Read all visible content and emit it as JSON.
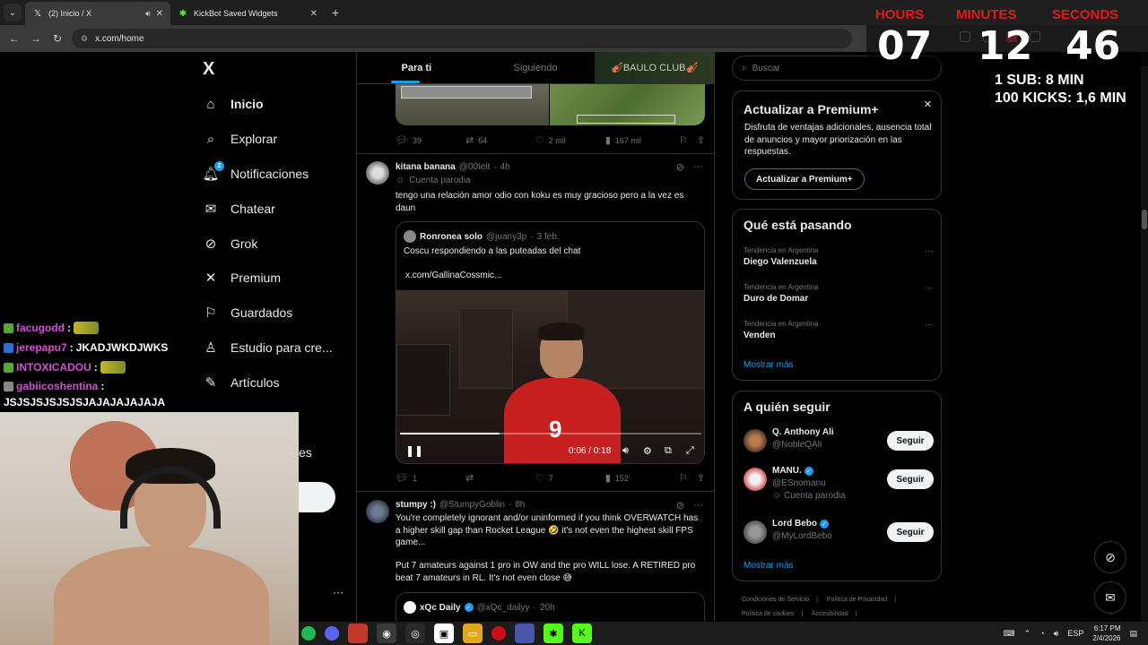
{
  "browser": {
    "tabs": [
      {
        "title": "(2) Inicio / X",
        "active": true
      },
      {
        "title": "KickBot Saved Widgets",
        "active": false
      }
    ],
    "new_tab": "+",
    "url": "x.com/home"
  },
  "nav": {
    "logo": "X",
    "items": [
      {
        "label": "Inicio",
        "icon": "home-icon",
        "glyph": "⌂",
        "active": true
      },
      {
        "label": "Explorar",
        "icon": "search-icon",
        "glyph": "⌕"
      },
      {
        "label": "Notificaciones",
        "icon": "bell-icon",
        "glyph": "🔔︎",
        "badge": "2"
      },
      {
        "label": "Chatear",
        "icon": "mail-icon",
        "glyph": "✉"
      },
      {
        "label": "Grok",
        "icon": "grok-icon",
        "glyph": "⊘"
      },
      {
        "label": "Premium",
        "icon": "x-premium-icon",
        "glyph": "✕"
      },
      {
        "label": "Guardados",
        "icon": "bookmark-icon",
        "glyph": "⚐"
      },
      {
        "label": "Estudio para cre...",
        "icon": "creator-studio-icon",
        "glyph": "♙"
      },
      {
        "label": "Artículos",
        "icon": "article-icon",
        "glyph": "✎"
      }
    ],
    "partial_label": "es",
    "more": "···"
  },
  "feed": {
    "tabs": [
      "Para ti",
      "Siguiendo",
      "🎻BAULO CLUB🎻"
    ],
    "post1_stats": {
      "replies": "39",
      "reposts": "64",
      "likes": "2 mil",
      "views": "167 mil"
    },
    "post2": {
      "name": "kitana banana",
      "handle": "@00teit",
      "time": "4h",
      "label": "Cuenta parodia",
      "text": "tengo una relación amor odio con koku es muy gracioso pero a la vez es daun",
      "quote": {
        "name": "Ronronea solo",
        "handle": "@juany3p",
        "date": "3 feb.",
        "text": "Coscu respondiendo a las puteadas del chat",
        "link": "x.com/GallinaCossmic...",
        "video_time": "0:06 / 0:18",
        "video_progress": 0.33,
        "jersey_number": "9"
      },
      "stats": {
        "replies": "1",
        "reposts": "",
        "likes": "7",
        "views": "152"
      }
    },
    "post3": {
      "name": "stumpy :)",
      "handle": "@StumpyGoblin",
      "time": "8h",
      "text1": "You're completely ignorant and/or uninformed if you think OVERWATCH has a higher skill gap than Rocket League 🤣 it's not even the highest skill FPS game...",
      "text2": "Put 7 amateurs against 1 pro in OW and the pro WILL lose. A RETIRED pro beat 7 amateurs in RL. It's not even close 😅",
      "quote": {
        "name": "xQc Daily",
        "handle": "@xQc_dailyy",
        "time": "20h"
      }
    }
  },
  "sidebar": {
    "search_placeholder": "Buscar",
    "premium": {
      "title": "Actualizar a Premium+",
      "text": "Disfruta de ventajas adicionales, ausencia total de anuncios y mayor priorización en las respuestas.",
      "button": "Actualizar a Premium+"
    },
    "trends": {
      "title": "Qué está pasando",
      "items": [
        {
          "context": "Tendencia en Argentina",
          "name": "Diego Valenzuela"
        },
        {
          "context": "Tendencia en Argentina",
          "name": "Duro de Domar"
        },
        {
          "context": "Tendencia en Argentina",
          "name": "Venden"
        }
      ],
      "more": "Mostrar más"
    },
    "who_to_follow": {
      "title": "A quién seguir",
      "items": [
        {
          "name": "Q. Anthony Ali",
          "handle": "@NobleQAli",
          "verified": false,
          "sub": ""
        },
        {
          "name": "MANU.",
          "handle": "@ESnomanu",
          "verified": true,
          "sub": "Cuenta parodia"
        },
        {
          "name": "Lord Bebo",
          "handle": "@MyLordBebo",
          "verified": true,
          "sub": ""
        }
      ],
      "follow_label": "Seguir",
      "more": "Mostrar más"
    },
    "footer": [
      "Condiciones de Servicio",
      "|",
      "Política de Privacidad",
      "|",
      "Política de cookies",
      "|",
      "Accesibilidad",
      "|"
    ]
  },
  "overlay": {
    "timer": {
      "hours_label": "HOURS",
      "minutes_label": "MINUTES",
      "seconds_label": "SECONDS",
      "hours": "07",
      "minutes": "12",
      "seconds": "46"
    },
    "note1": "1 SUB: 8 MIN",
    "note2": "100 KICKS: 1,6 MIN",
    "chat": [
      {
        "user": "facugodd",
        "sep": ":",
        "msg": "",
        "emote": true,
        "badge_color": "#53a83a"
      },
      {
        "user": "jerepapu7",
        "sep": ":",
        "msg": "JKADJWKDJWKS",
        "emote": false,
        "badge_color": "#2f6fd1"
      },
      {
        "user": "INTOXICADOU",
        "sep": ":",
        "msg": "",
        "emote": true,
        "badge_color": "#53a83a"
      },
      {
        "user": "gabiicoshentina",
        "sep": ":",
        "msg": "",
        "emote": false,
        "badge_color": "#888888"
      }
    ],
    "chat_wrap": "JSJSJSJSJSJSJAJAJAJAJAJA"
  },
  "taskbar": {
    "lang": "ESP",
    "time": "6:17 PM",
    "date": "2/4/2026"
  },
  "colors": {
    "accent": "#1d9bf0",
    "bg": "#000000",
    "timer_label": "#e01a1a"
  }
}
